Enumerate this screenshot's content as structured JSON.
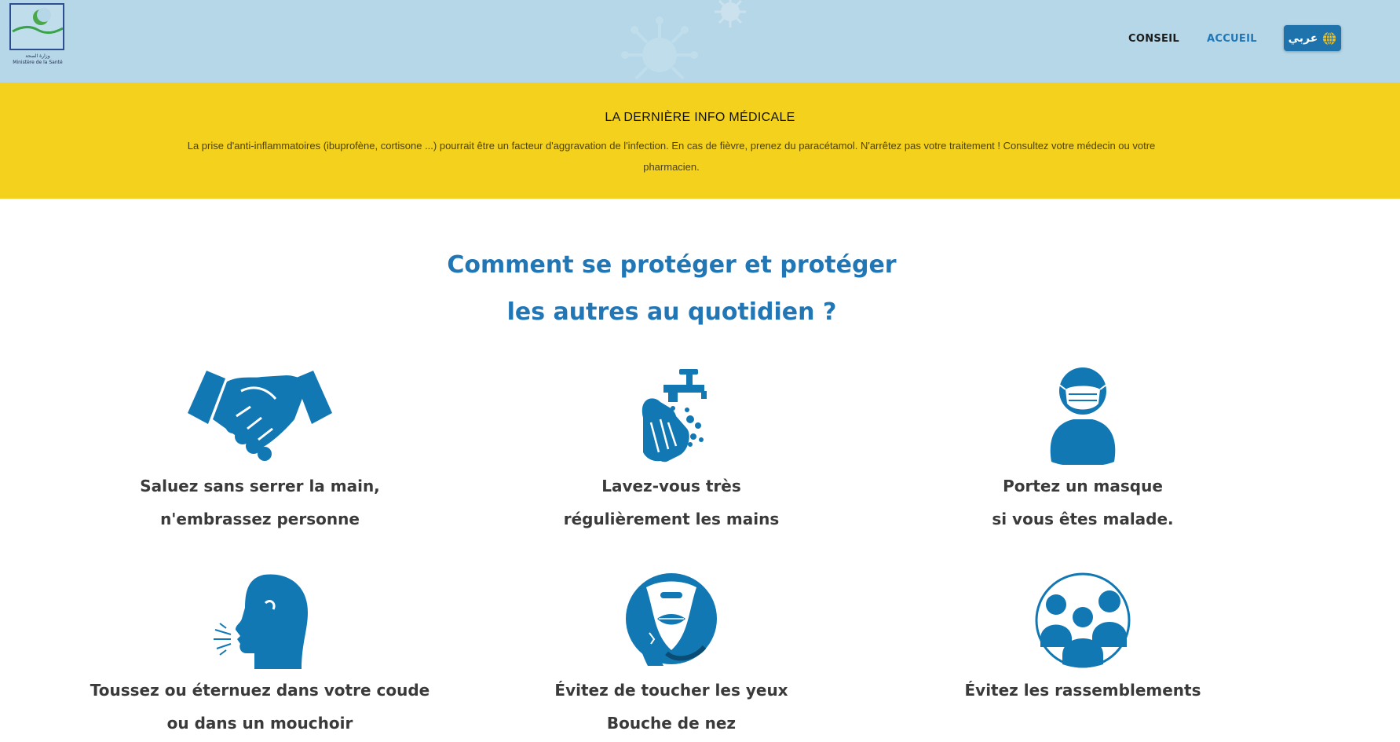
{
  "header": {
    "logo_caption_ar": "وزارة الصحة",
    "logo_caption_fr": "Ministère de la Santé",
    "nav": [
      {
        "label": "CONSEIL"
      },
      {
        "label": "ACCUEIL"
      }
    ],
    "language_button": {
      "label": "عربي",
      "icon": "globe-icon"
    }
  },
  "banner": {
    "title": "LA DERNIÈRE INFO MÉDICALE",
    "text": "La prise d'anti-inflammatoires (ibuprofène, cortisone ...) pourrait être un facteur d'aggravation de l'infection. En cas de fièvre, prenez du paracétamol. N'arrêtez pas votre traitement ! Consultez votre médecin ou votre pharmacien."
  },
  "heading": {
    "line1": "Comment se protéger et protéger",
    "line2": "les autres au quotidien ?"
  },
  "tips": [
    {
      "icon": "handshake-icon",
      "line1": "Saluez sans serrer la main,",
      "line2": "n'embrassez personne"
    },
    {
      "icon": "handwashing-icon",
      "line1": "Lavez-vous très",
      "line2": "régulièrement les mains"
    },
    {
      "icon": "face-mask-icon",
      "line1": "Portez un masque",
      "line2": "si vous êtes malade."
    },
    {
      "icon": "cough-elbow-icon",
      "line1": "Toussez ou éternuez dans votre coude",
      "line2": "ou dans un mouchoir"
    },
    {
      "icon": "no-touch-face-icon",
      "line1": "Évitez de toucher les yeux",
      "line2": "Bouche de nez"
    },
    {
      "icon": "crowd-icon",
      "line1": "Évitez les rassemblements",
      "line2": ""
    }
  ],
  "colors": {
    "header_bg": "#b5d7e8",
    "banner_bg": "#f3d11c",
    "accent_blue": "#2176b6",
    "icon_blue": "#1278b4",
    "text_dark": "#3a3a3a"
  }
}
